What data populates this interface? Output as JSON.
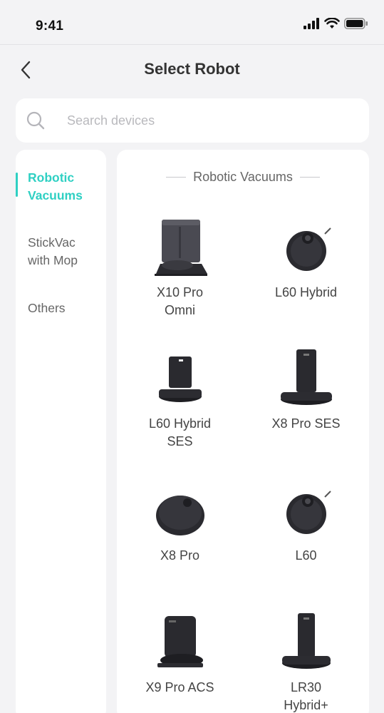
{
  "status_bar": {
    "time": "9:41",
    "icons": [
      "signal-icon",
      "wifi-icon",
      "battery-icon"
    ]
  },
  "nav": {
    "title": "Select Robot",
    "back_icon": "chevron-left-icon"
  },
  "search": {
    "placeholder": "Search devices",
    "value": "",
    "icon": "search-icon"
  },
  "sidebar": {
    "items": [
      {
        "label": "Robotic\nVacuums",
        "active": true
      },
      {
        "label": "StickVac\nwith Mop",
        "active": false
      },
      {
        "label": "Others",
        "active": false
      }
    ]
  },
  "section": {
    "title": "Robotic Vacuums"
  },
  "devices": [
    {
      "name": "X10 Pro\nOmni",
      "icon": "robot-station-icon"
    },
    {
      "name": "L60 Hybrid",
      "icon": "robot-vacuum-icon"
    },
    {
      "name": "L60 Hybrid\nSES",
      "icon": "robot-station-icon"
    },
    {
      "name": "X8 Pro SES",
      "icon": "robot-station-icon"
    },
    {
      "name": "X8 Pro",
      "icon": "robot-vacuum-icon"
    },
    {
      "name": "L60",
      "icon": "robot-vacuum-icon"
    },
    {
      "name": "X9 Pro ACS",
      "icon": "robot-station-icon"
    },
    {
      "name": "LR30\nHybrid+",
      "icon": "robot-station-icon"
    }
  ],
  "colors": {
    "accent": "#2fd0c3",
    "background": "#f3f3f5",
    "card": "#ffffff"
  }
}
